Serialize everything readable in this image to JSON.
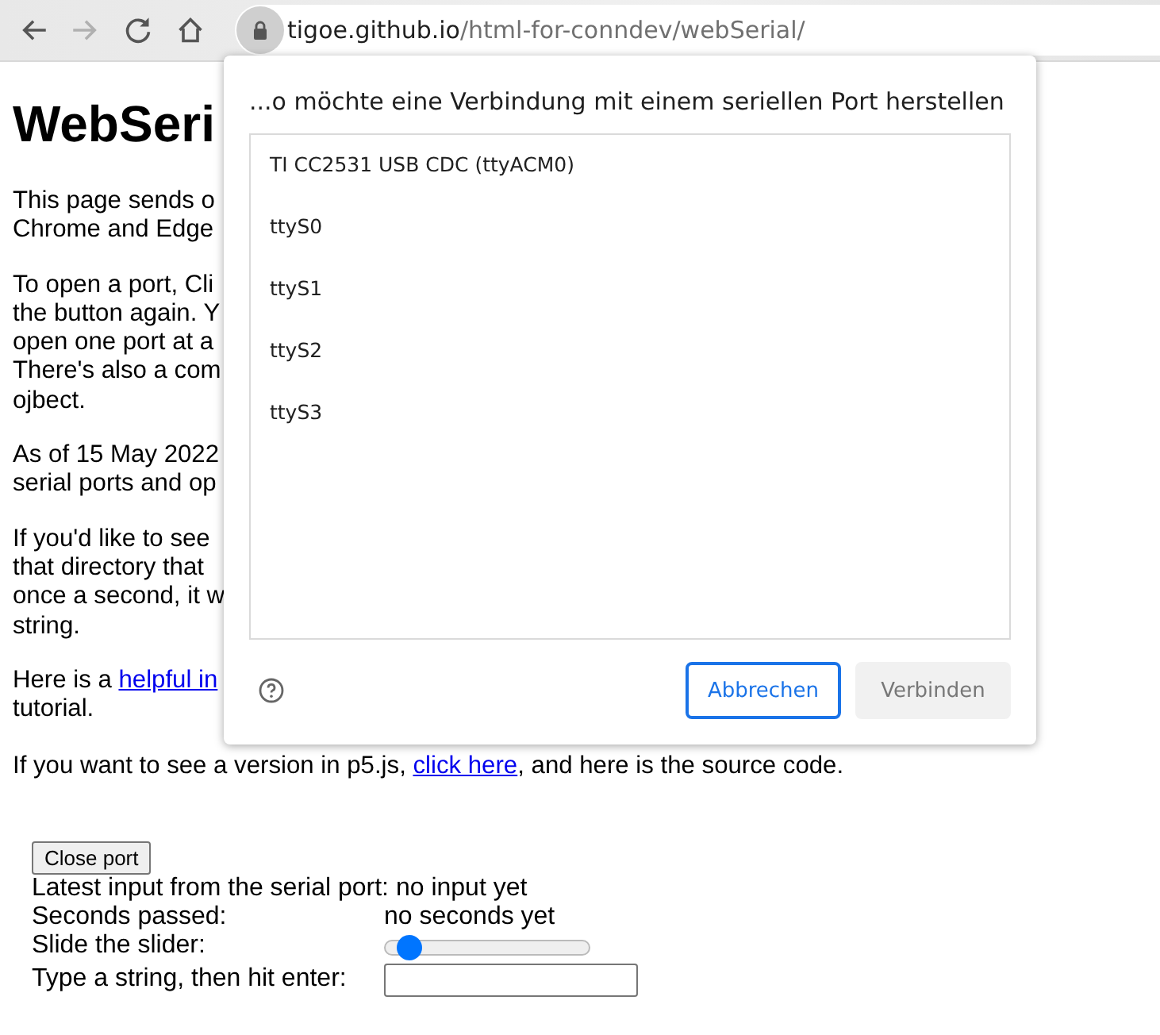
{
  "toolbar": {
    "buttons": [
      {
        "kind": "back",
        "disabled": false
      },
      {
        "kind": "forward",
        "disabled": true
      },
      {
        "kind": "reload",
        "disabled": false
      },
      {
        "kind": "home",
        "disabled": false
      }
    ],
    "address": {
      "host": "tigoe.github.io",
      "path": "/html-for-conndev/webSerial/"
    }
  },
  "page": {
    "title": "WebSeri",
    "paragraphs": [
      {
        "lines": [
          {
            "text": "This page sends o"
          },
          {
            "text": "Chrome and Edge"
          }
        ]
      },
      {
        "lines": [
          {
            "text": "To open a port, Cli"
          },
          {
            "text": "the button again. Y"
          },
          {
            "text": "open one port at a"
          },
          {
            "text": "There's also a com"
          },
          {
            "text": "ojbect."
          }
        ]
      },
      {
        "lines": [
          {
            "text": "As of 15 May 2022"
          },
          {
            "text": "serial ports and op"
          }
        ]
      },
      {
        "lines": [
          {
            "text": "If you'd like to see"
          },
          {
            "text": "that directory that"
          },
          {
            "text": "once a second, it w"
          },
          {
            "text": "string."
          }
        ]
      },
      {
        "lines": [
          {
            "text": "Here is a ",
            "link": "helpful in"
          },
          {
            "text": "tutorial."
          }
        ]
      },
      {
        "lines": [
          {
            "text": "If you want to see a version in p5.js, ",
            "link": "click here",
            "after": ", and here is the source code."
          }
        ]
      }
    ],
    "close_button": "Close port",
    "rows": [
      {
        "kind": "text",
        "label": "Latest input from the serial port: no input yet"
      },
      {
        "kind": "pair",
        "label": "Seconds passed:",
        "value": "no seconds yet"
      },
      {
        "kind": "slider",
        "label": "Slide the slider:",
        "level": 0.07
      },
      {
        "kind": "input",
        "label": "Type a string, then hit enter:"
      }
    ]
  },
  "dialog": {
    "title": "...o möchte eine Verbindung mit einem seriellen Port herstellen",
    "ports": [
      {
        "name": "TI CC2531 USB CDC (ttyACM0)",
        "selected": false
      },
      {
        "name": "ttyS0",
        "selected": false
      },
      {
        "name": "ttyS1",
        "selected": false
      },
      {
        "name": "ttyS2",
        "selected": false
      },
      {
        "name": "ttyS3",
        "selected": false
      }
    ],
    "buttons": [
      {
        "label": "Abbrechen",
        "kind": "secondary",
        "disabled": false
      },
      {
        "label": "Verbinden",
        "kind": "primary",
        "disabled": true
      }
    ]
  }
}
